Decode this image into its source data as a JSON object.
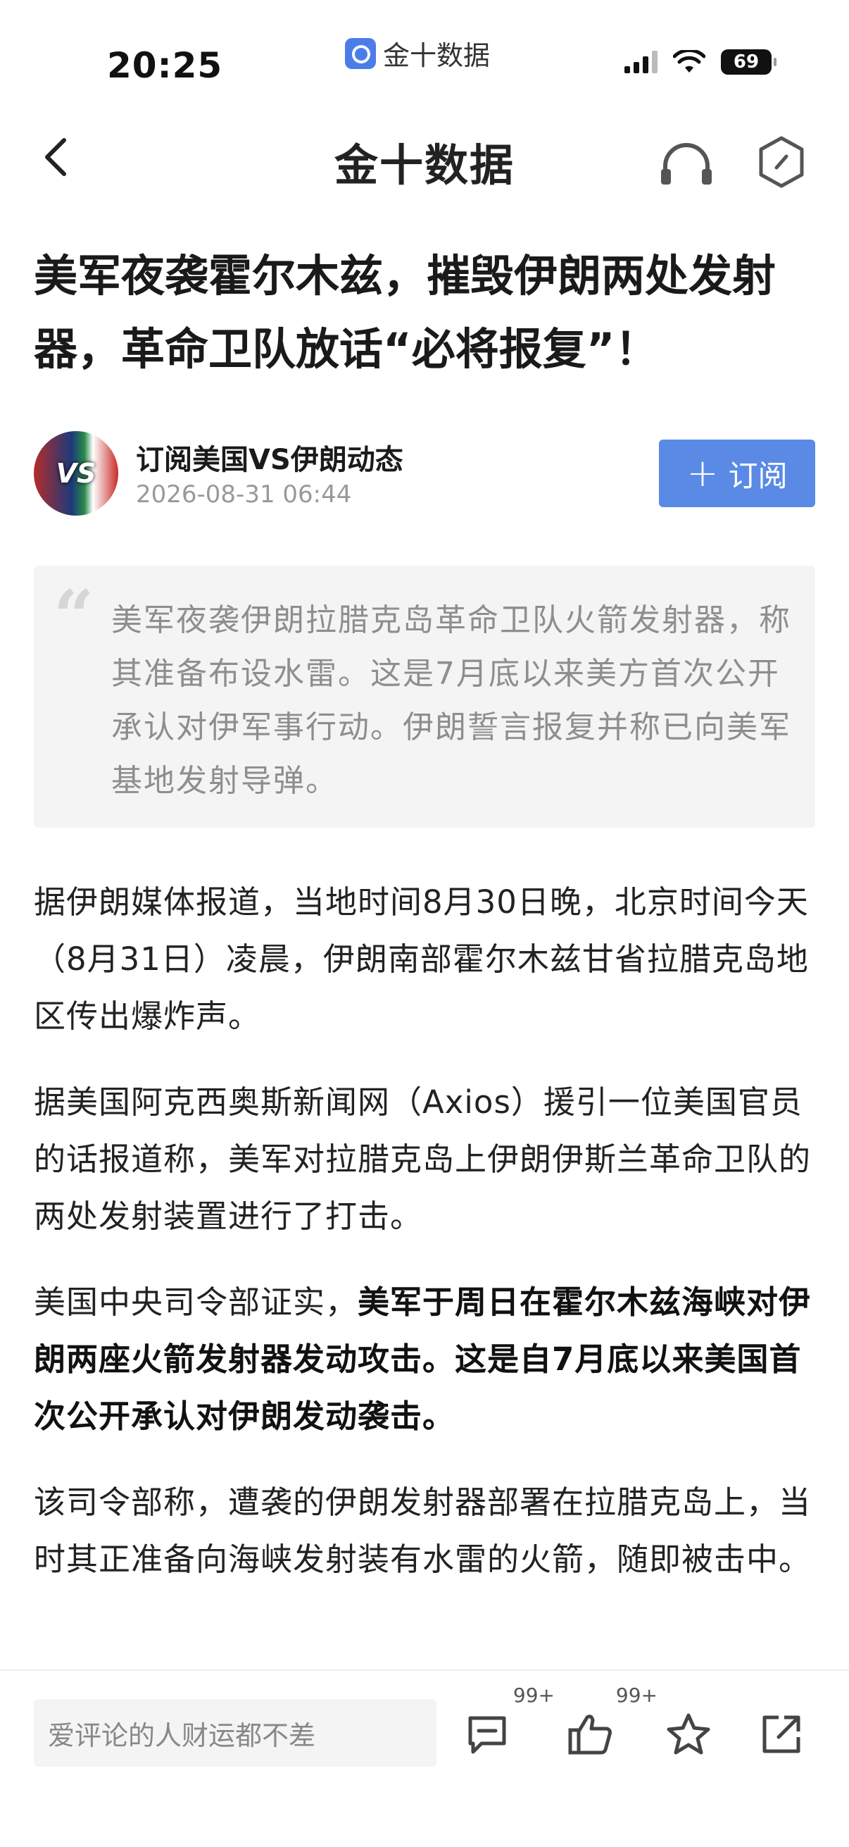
{
  "status_bar": {
    "time": "20:25",
    "app_label": "金十数据",
    "battery": "69"
  },
  "nav": {
    "title": "金十数据"
  },
  "article": {
    "title": "美军夜袭霍尔木兹，摧毁伊朗两处发射器，革命卫队放话“必将报复”！",
    "author_name": "订阅美国VS伊朗动态",
    "date": "2026-08-31 06:44",
    "subscribe_label": "订阅",
    "avatar_text": "VS",
    "summary": "美军夜袭伊朗拉腊克岛革命卫队火箭发射器，称其准备布设水雷。这是7月底以来美方首次公开承认对伊军事行动。伊朗誓言报复并称已向美军基地发射导弹。",
    "paragraphs": [
      "据伊朗媒体报道，当地时间8月30日晚，北京时间今天（8月31日）凌晨，伊朗南部霍尔木兹甘省拉腊克岛地区传出爆炸声。",
      "据美国阿克西奥斯新闻网（Axios）援引一位美国官员的话报道称，美军对拉腊克岛上伊朗伊斯兰革命卫队的两处发射装置进行了打击。"
    ],
    "paragraph3_plain": "美国中央司令部证实，",
    "paragraph3_bold": "美军于周日在霍尔木兹海峡对伊朗两座火箭发射器发动攻击。这是自7月底以来美国首次公开承认对伊朗发动袭击。",
    "paragraph4": "该司令部称，遭袭的伊朗发射器部署在拉腊克岛上，当时其正准备向海峡发射装有水雷的火箭，随即被击中。"
  },
  "bottom_bar": {
    "comment_placeholder": "爱评论的人财运都不差",
    "comment_count": "99+",
    "like_count": "99+"
  },
  "icons": {
    "back": "chevron-left-icon",
    "headphone": "headphone-icon",
    "share": "hexagon-share-icon",
    "comment": "comment-icon",
    "like": "thumbs-up-icon",
    "favorite": "star-icon",
    "forward": "share-out-icon"
  },
  "colors": {
    "accent": "#5a8ae6",
    "summary_bg": "#f4f4f4",
    "summary_text": "#8e8e8e"
  }
}
